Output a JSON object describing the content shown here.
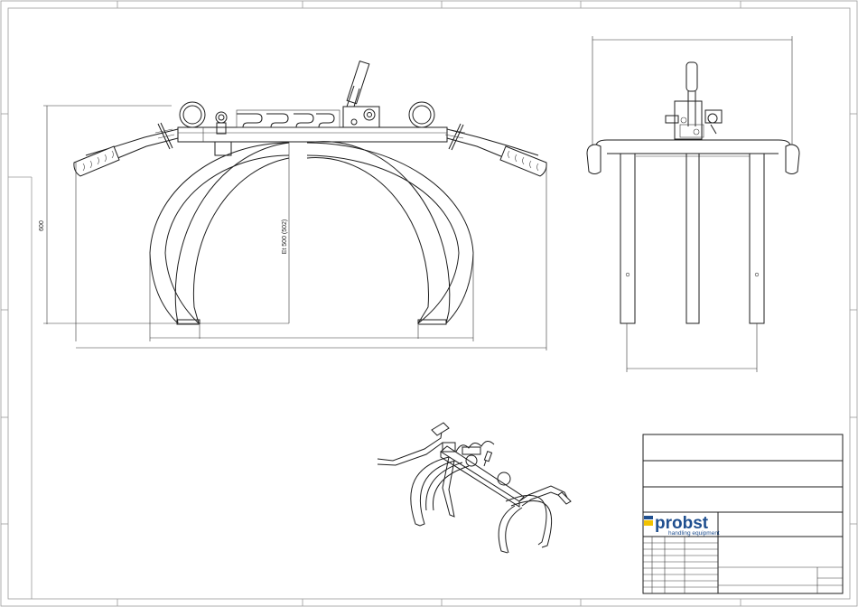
{
  "dimensions": {
    "height_label": "600",
    "inner_label": "Et 500 (502)"
  },
  "logo": {
    "brand": "probst",
    "tagline": "handling equipment",
    "colors": {
      "blue": "#1f4f8f",
      "yellow": "#f2c200"
    }
  },
  "views": [
    "front-view",
    "side-view",
    "isometric-view"
  ]
}
